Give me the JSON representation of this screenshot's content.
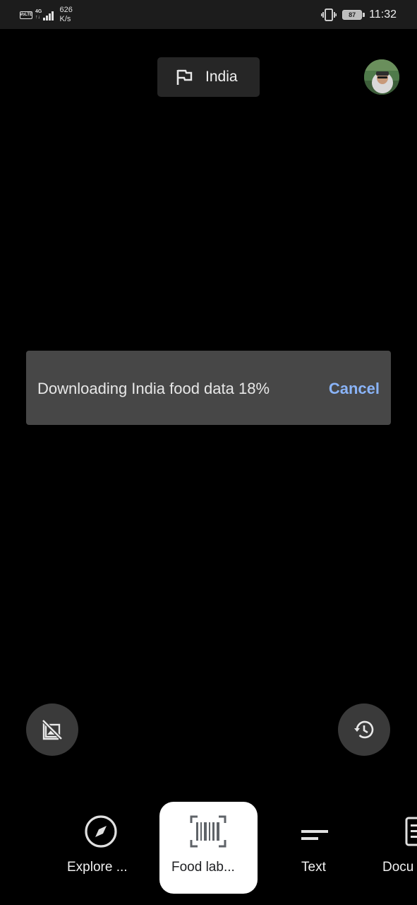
{
  "status_bar": {
    "volte_label": "VoLTE",
    "network_gen": "4G",
    "network_sub": "↑↓",
    "speed_value": "626",
    "speed_unit": "K/s",
    "battery_level": "87",
    "time": "11:32",
    "icons": [
      "volte-icon",
      "signal-icon",
      "vibrate-icon",
      "battery-icon"
    ]
  },
  "header": {
    "country_label": "India",
    "country_icon": "flag-icon",
    "avatar_icon": "account-avatar"
  },
  "snackbar": {
    "message": "Downloading India food data 18%",
    "progress_percent": 18,
    "action_label": "Cancel",
    "action_color": "#8ab4f8"
  },
  "floating_buttons": {
    "left_icon": "no-gallery-icon",
    "right_icon": "history-icon"
  },
  "mode_tabs": [
    {
      "label": "Explore ...",
      "icon": "compass-icon",
      "selected": false
    },
    {
      "label": "Food lab...",
      "icon": "barcode-icon",
      "selected": true
    },
    {
      "label": "Text",
      "icon": "text-lines-icon",
      "selected": false
    },
    {
      "label": "Docu",
      "icon": "document-icon",
      "selected": false
    }
  ],
  "colors": {
    "background": "#000000",
    "status_bar": "#1c1c1c",
    "snackbar": "#474747",
    "round_button": "#3a3a3a",
    "selected_tab": "#ffffff",
    "accent": "#8ab4f8"
  }
}
